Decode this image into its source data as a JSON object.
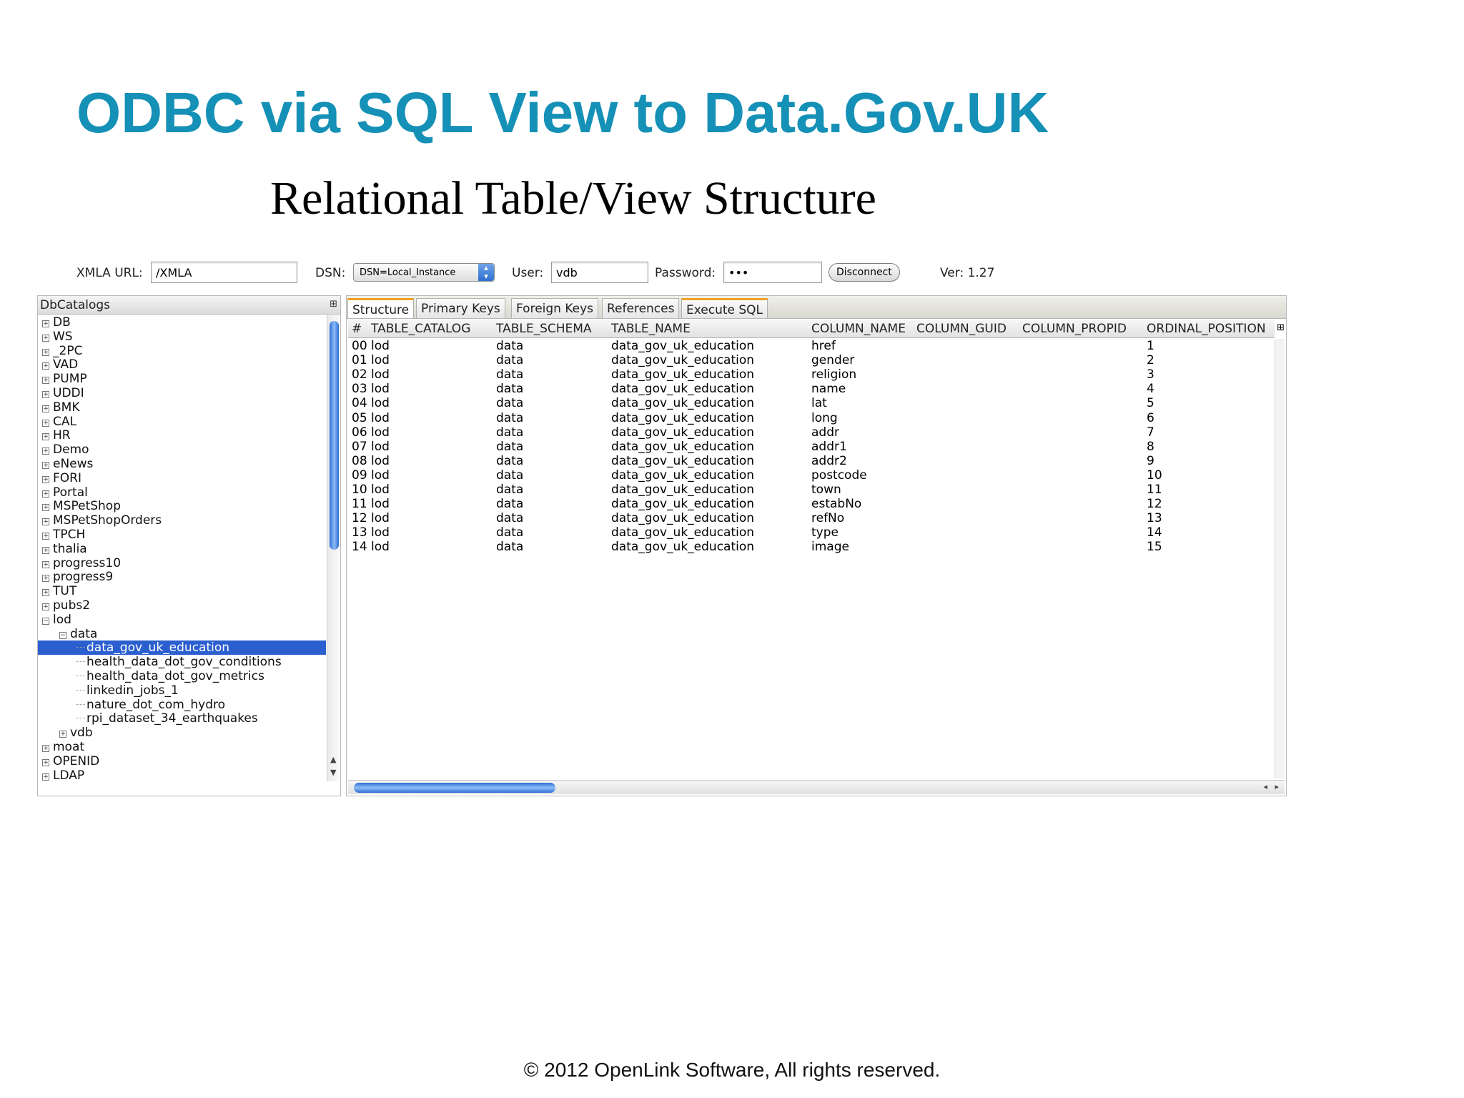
{
  "slide": {
    "title": "ODBC via SQL View to Data.Gov.UK",
    "subtitle": "Relational Table/View Structure",
    "footer": "© 2012 OpenLink Software, All rights reserved."
  },
  "connection": {
    "xmla_label": "XMLA URL:",
    "xmla_value": "/XMLA",
    "dsn_label": "DSN:",
    "dsn_value": "DSN=Local_Instance",
    "user_label": "User:",
    "user_value": "vdb",
    "password_label": "Password:",
    "password_value": "•••",
    "disconnect_label": "Disconnect",
    "version": "Ver: 1.27"
  },
  "tree": {
    "header": "DbCatalogs",
    "items": [
      {
        "label": "DB",
        "depth": 0,
        "toggle": "+"
      },
      {
        "label": "WS",
        "depth": 0,
        "toggle": "+"
      },
      {
        "label": "_2PC",
        "depth": 0,
        "toggle": "+"
      },
      {
        "label": "VAD",
        "depth": 0,
        "toggle": "+"
      },
      {
        "label": "PUMP",
        "depth": 0,
        "toggle": "+"
      },
      {
        "label": "UDDI",
        "depth": 0,
        "toggle": "+"
      },
      {
        "label": "BMK",
        "depth": 0,
        "toggle": "+"
      },
      {
        "label": "CAL",
        "depth": 0,
        "toggle": "+"
      },
      {
        "label": "HR",
        "depth": 0,
        "toggle": "+"
      },
      {
        "label": "Demo",
        "depth": 0,
        "toggle": "+"
      },
      {
        "label": "eNews",
        "depth": 0,
        "toggle": "+"
      },
      {
        "label": "FORI",
        "depth": 0,
        "toggle": "+"
      },
      {
        "label": "Portal",
        "depth": 0,
        "toggle": "+"
      },
      {
        "label": "MSPetShop",
        "depth": 0,
        "toggle": "+"
      },
      {
        "label": "MSPetShopOrders",
        "depth": 0,
        "toggle": "+"
      },
      {
        "label": "TPCH",
        "depth": 0,
        "toggle": "+"
      },
      {
        "label": "thalia",
        "depth": 0,
        "toggle": "+"
      },
      {
        "label": "progress10",
        "depth": 0,
        "toggle": "+"
      },
      {
        "label": "progress9",
        "depth": 0,
        "toggle": "+"
      },
      {
        "label": "TUT",
        "depth": 0,
        "toggle": "+"
      },
      {
        "label": "pubs2",
        "depth": 0,
        "toggle": "+"
      },
      {
        "label": "lod",
        "depth": 0,
        "toggle": "−"
      },
      {
        "label": "data",
        "depth": 1,
        "toggle": "−"
      },
      {
        "label": "data_gov_uk_education",
        "depth": 2,
        "toggle": "",
        "selected": true
      },
      {
        "label": "health_data_dot_gov_conditions",
        "depth": 2,
        "toggle": ""
      },
      {
        "label": "health_data_dot_gov_metrics",
        "depth": 2,
        "toggle": ""
      },
      {
        "label": "linkedin_jobs_1",
        "depth": 2,
        "toggle": ""
      },
      {
        "label": "nature_dot_com_hydro",
        "depth": 2,
        "toggle": ""
      },
      {
        "label": "rpi_dataset_34_earthquakes",
        "depth": 2,
        "toggle": ""
      },
      {
        "label": "vdb",
        "depth": 1,
        "toggle": "+"
      },
      {
        "label": "moat",
        "depth": 0,
        "toggle": "+"
      },
      {
        "label": "OPENID",
        "depth": 0,
        "toggle": "+"
      },
      {
        "label": "LDAP",
        "depth": 0,
        "toggle": "+"
      }
    ]
  },
  "tabs": [
    "Structure",
    "Primary Keys",
    "Foreign Keys",
    "References",
    "Execute SQL"
  ],
  "grid": {
    "columns": [
      "#",
      "TABLE_CATALOG",
      "TABLE_SCHEMA",
      "TABLE_NAME",
      "COLUMN_NAME",
      "COLUMN_GUID",
      "COLUMN_PROPID",
      "ORDINAL_POSITION"
    ],
    "rows": [
      [
        "00 lod",
        "data",
        "data_gov_uk_education",
        "href",
        "1"
      ],
      [
        "01 lod",
        "data",
        "data_gov_uk_education",
        "gender",
        "2"
      ],
      [
        "02 lod",
        "data",
        "data_gov_uk_education",
        "religion",
        "3"
      ],
      [
        "03 lod",
        "data",
        "data_gov_uk_education",
        "name",
        "4"
      ],
      [
        "04 lod",
        "data",
        "data_gov_uk_education",
        "lat",
        "5"
      ],
      [
        "05 lod",
        "data",
        "data_gov_uk_education",
        "long",
        "6"
      ],
      [
        "06 lod",
        "data",
        "data_gov_uk_education",
        "addr",
        "7"
      ],
      [
        "07 lod",
        "data",
        "data_gov_uk_education",
        "addr1",
        "8"
      ],
      [
        "08 lod",
        "data",
        "data_gov_uk_education",
        "addr2",
        "9"
      ],
      [
        "09 lod",
        "data",
        "data_gov_uk_education",
        "postcode",
        "10"
      ],
      [
        "10 lod",
        "data",
        "data_gov_uk_education",
        "town",
        "11"
      ],
      [
        "11 lod",
        "data",
        "data_gov_uk_education",
        "estabNo",
        "12"
      ],
      [
        "12 lod",
        "data",
        "data_gov_uk_education",
        "refNo",
        "13"
      ],
      [
        "13 lod",
        "data",
        "data_gov_uk_education",
        "type",
        "14"
      ],
      [
        "14 lod",
        "data",
        "data_gov_uk_education",
        "image",
        "15"
      ]
    ]
  }
}
